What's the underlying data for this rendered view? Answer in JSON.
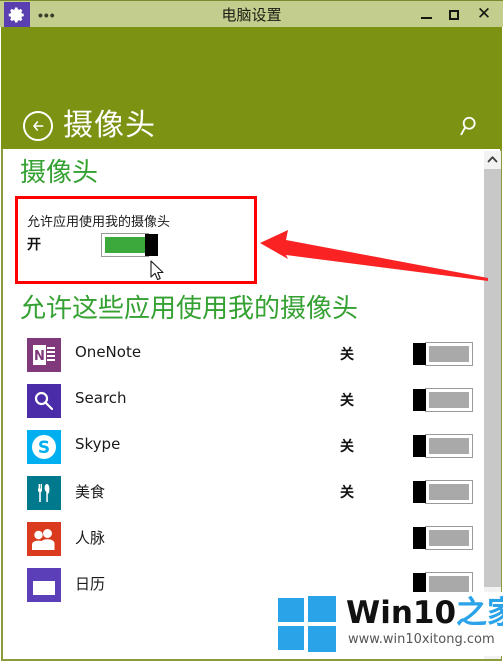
{
  "window": {
    "title": "电脑设置",
    "logo_icon": "gear-icon",
    "ellipsis": "•••",
    "minimize_label": "—",
    "maximize_label": "□",
    "close_label": "✕",
    "titlebar_color": "#c3cd8e",
    "logo_bg_color": "#5a3fb0"
  },
  "header": {
    "title": "摄像头",
    "back_icon": "back-arrow-icon",
    "search_icon": "search-icon",
    "bg_color": "#7b9213"
  },
  "main": {
    "section1_title": "摄像头",
    "section2_title": "允许这些应用使用我的摄像头",
    "section_title_color": "#35a132",
    "permission": {
      "label": "允许应用使用我的摄像头",
      "state": "开",
      "toggle_on": true,
      "on_color": "#3ba93b"
    },
    "apps": [
      {
        "name": "OneNote",
        "state": "关",
        "toggle_on": false,
        "icon": "onenote-icon",
        "icon_color": "#80397b",
        "glyph": "N"
      },
      {
        "name": "Search",
        "state": "关",
        "toggle_on": false,
        "icon": "search-app-icon",
        "icon_color": "#4b2ca8",
        "glyph": "search"
      },
      {
        "name": "Skype",
        "state": "关",
        "toggle_on": false,
        "icon": "skype-icon",
        "icon_color": "#00aff0",
        "glyph": "S"
      },
      {
        "name": "美食",
        "state": "关",
        "toggle_on": false,
        "icon": "food-icon",
        "icon_color": "#00798c",
        "glyph": "cutlery"
      },
      {
        "name": "人脉",
        "state": "",
        "toggle_on": false,
        "icon": "people-icon",
        "icon_color": "#da3b1f",
        "glyph": "people"
      },
      {
        "name": "日历",
        "state": "",
        "toggle_on": false,
        "icon": "calendar-icon",
        "icon_color": "#5b3fb8",
        "glyph": "calendar"
      }
    ]
  },
  "annotations": {
    "highlight_box_color": "#ff0000",
    "arrow_color": "#fa2222"
  },
  "watermark": {
    "brand_black": "Win10",
    "brand_blue": "之家",
    "url": "www.win10xitong.com",
    "logo_color": "#2aa3e8"
  },
  "scrollbar": {
    "up_arrow": "chevron-up-icon"
  }
}
